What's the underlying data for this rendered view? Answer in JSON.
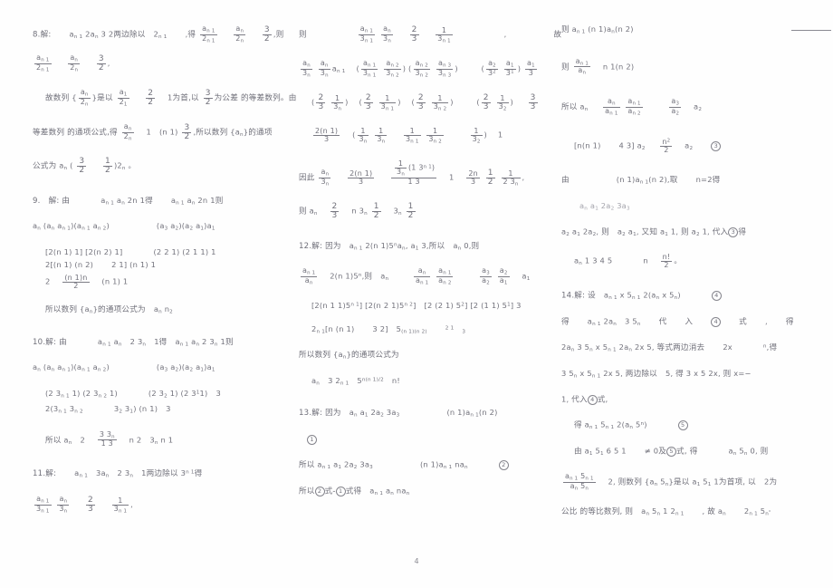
{
  "document": {
    "kind": "scanned-math-answer-key",
    "page_number": "4",
    "language": "zh-CN"
  },
  "columns": {
    "left": {
      "problems": [
        {
          "number": "8.",
          "label": "解:",
          "lines": [
            {
              "id": "l8-1",
              "text": "8.解:　　 a n 1  2a n  3 2两边除以　 2 n 1　　,得"
            },
            {
              "id": "l8-1f",
              "fraction_a_num": "a n 1",
              "fraction_a_den": "2 n 1",
              "fraction_b_num": "a n",
              "fraction_b_den": "2 n",
              "fraction_c_num": "3",
              "fraction_c_den": "2",
              "tail": "则"
            },
            {
              "id": "l8-2",
              "text": ""
            },
            {
              "id": "l8-3",
              "text": "故数列 {",
              "inner": "a n",
              "inner_den": "2 n",
              "text2": "}是以",
              "frac1_num": "a 1",
              "frac1_den": "2 1",
              "frac2_num": "2",
              "frac2_den": "2",
              "mid": "1为首,以",
              "frac3_num": "3",
              "frac3_den": "2",
              "tail": "为公差 的等差数列,由"
            },
            {
              "id": "l8-4",
              "text": "等差数列 的通项公式,得",
              "frac_num": "a n",
              "frac_den": "2 n",
              "mid": "1　(n 1)",
              "frac2_num": "3",
              "frac2_den": "2",
              "tail": ",所以数列 {a n }的通项"
            },
            {
              "id": "l8-5",
              "text": "公式为 a n  (",
              "frac1_num": "3",
              "frac1_den": "2",
              "frac2_num": "1",
              "frac2_den": "2",
              "tail": ")2 n 。"
            }
          ]
        },
        {
          "number": "9.",
          "label": "解: 由",
          "lines": [
            {
              "id": "l9-1",
              "text": "9.　解: 由　　　 a n 1  a n  2n  1得　　 a n 1  a n  2n  1则"
            },
            {
              "id": "l9-2",
              "text": "a n  (a n  a n 1 ) (a n 1  a n 2 )　　　　 (a 3  a 2 ) (a 2  a 1 ) a 1"
            },
            {
              "id": "l9-3",
              "text": "[2(n 1)  1] [2(n 2)  1]　　 (2 2 1) (2 1 1) 1"
            },
            {
              "id": "l9-4",
              "text": "2[(n 1) (n 2)　　　 2 1] (n 1)  1"
            },
            {
              "id": "l9-5",
              "text": "2",
              "frac_num": "(n 1)n",
              "frac_den": "2",
              "tail": "(n 1) 1"
            },
            {
              "id": "l9-6",
              "text": "所以数列 {a n }的通项公式为　 a n  n 2"
            }
          ]
        },
        {
          "number": "10.",
          "label": "解: 由",
          "lines": [
            {
              "id": "l10-1",
              "text": "10.解: 由　　　 a n 1  a n 　 2 3 n 　1得　 a n 1  a n  2 3 n  1则"
            },
            {
              "id": "l10-2",
              "text": "a n  (a n  a n 1 ) (a n 1  a n 2 )　　　　 (a 3  a 2 ) (a 2  a 1 ) a 1"
            },
            {
              "id": "l10-3",
              "text": "(2 3 n 1  1) (2 3 n 2  1)　　　 (2 3 2  1) (2 3 1 1)  3"
            },
            {
              "id": "l10-4",
              "text": "2(3 n 1  3 n 2 　　　 3 2  3 1 ) (n 1)  3"
            },
            {
              "id": "l10-5",
              "text": "所以 a n  2",
              "frac_num": "3  3 n",
              "frac_den": "1  3",
              "tail": "n  2  3 n  n  1"
            }
          ]
        },
        {
          "number": "11.",
          "label": "解:",
          "lines": [
            {
              "id": "l11-1",
              "text": "11.解:　 a n 1  3a n 　 2 3 n 　1两边除以 3 n 1 得"
            },
            {
              "id": "l11-2",
              "frac1_num": "a n 1",
              "frac1_den": "3 n 1",
              "frac2_num": "a n",
              "frac2_den": "3 n",
              "frac3_num": "2",
              "frac3_den": "3",
              "frac4_num": "1",
              "frac4_den": "3 n 1",
              "tail": ","
            }
          ]
        }
      ]
    },
    "middle": {
      "problems": [
        {
          "number": "11. (cont.)",
          "lines": [
            {
              "id": "m-1",
              "lead": "则",
              "frac1_num": "a n 1",
              "frac1_den": "3 n 1",
              "frac2_num": "a n",
              "frac2_den": "3 n",
              "frac3_num": "2",
              "frac3_den": "3",
              "frac4_num": "1",
              "frac4_den": "3 n 1",
              "tail": ",　　　　　 故"
            },
            {
              "id": "m-2",
              "frac1_num": "a n",
              "frac1_den": "3 n",
              "mid": "a  n a",
              "mid2": "3  n  a n 1",
              "text": "(",
              "f2n": "a n 1",
              "f2d": "3 n 1",
              "f3n": "a n 2",
              "f3d": "3 n 2",
              "f4n": "a n 2  a n 3",
              "f4d": "3 n 2  3 n 3",
              "f5n": "a 2  a 1",
              "f5d": "3 2  3 1",
              "f6n": "a 1",
              "f6d": "3"
            },
            {
              "id": "m-3",
              "text": "(",
              "f1n": "2",
              "f1d": "3",
              "f2n": "1",
              "f2d": "3 n",
              "t1": ") (",
              "f3n": "2",
              "f3d": "3",
              "f4n": "1",
              "f4d": "3 n 1",
              "t2": ") (",
              "f5n": "2",
              "f5d": "3",
              "f6n": "1",
              "f6d": "3 n 2",
              "t3": ")　　 (",
              "f7n": "2",
              "f7d": "3",
              "f8n": "1",
              "f8d": "3 2",
              "t4": ")",
              "f9n": "3",
              "f9d": "3"
            },
            {
              "id": "m-4",
              "fAn": "2(n 1)",
              "fAd": "3",
              "t1": "(",
              "fBn": "1",
              "fBd": "3 n",
              "fCn": "1",
              "fCd": "3 n",
              "fDn": "1",
              "fDd": "3 n 1",
              "fEn": "1",
              "fEd": "3 n 2",
              "t2": "　　",
              "fFn": "1",
              "fFd": "3 2",
              "t3": ") 1"
            },
            {
              "id": "m-5",
              "lead": "因此",
              "fAn": "a n",
              "fAd": "3 n",
              "fBn": "2(n 1)",
              "fBd": "3",
              "fCn_top": "1",
              "fCn_bot": "3 n",
              "fCn_tail": "(1  3 n 1 )",
              "fCd": "1  3",
              "t1": "1",
              "fDn": "2n",
              "fDd": "3",
              "fEn": "1",
              "fEd": "2",
              "fFn": "1",
              "fFd": "2  3 n",
              "t2": ","
            },
            {
              "id": "m-6",
              "lead": "则 a n",
              "fAn": "2",
              "fAd": "3",
              "t1": "n  3 n",
              "fBn": "1",
              "fBd": "2",
              "t2": "3 n",
              "fCn": "1",
              "fCd": "2"
            }
          ]
        },
        {
          "number": "12.",
          "label": "解: 因为",
          "lines": [
            {
              "id": "m12-1",
              "text": "12.解: 因为　 a n 1  2(n  1)5 n a n , a 1  3,所以　 a n  0,则"
            },
            {
              "id": "m12-2",
              "fAn": "a n 1",
              "fAd": "a n",
              "t1": "2(n  1)5 n , 则　 a n",
              "fBn": "a n",
              "fBd": "a n 1",
              "fCn": "a n 1",
              "fCd": "a n 2",
              "fDn": "a 3",
              "fDd": "a 2",
              "fEn": "a 2",
              "fEd": "a 1",
              "t2": "a 1"
            },
            {
              "id": "m12-3",
              "text": "[2(n  1  1)5 n 1 ] [2(n  2  1)5 n 2 ]　 [2 (2  1)  5 2 ] [2 (1  1)  5 1 ] 3"
            },
            {
              "id": "m12-4",
              "text": "2 n 1 [n  (n  1)　　　 3  2] 5 (n 1) (n 2)　 2 1　3"
            },
            {
              "id": "m12-5",
              "text": "所以数列 {a n }的通项公式为"
            },
            {
              "id": "m12-6",
              "text": "a n  3  2 n 1  5",
              "exp": "n(n 1)/2",
              "tail": "n!"
            }
          ]
        },
        {
          "number": "13.",
          "label": "解: 因为",
          "lines": [
            {
              "id": "m13-1",
              "text": "13.解: 因为　 a n  a 1  2a 2  3a 3 　　　　 (n  1)a n 1 (n  2)"
            },
            {
              "id": "m13-2",
              "text": "①"
            },
            {
              "id": "m13-3",
              "text": "所以 a n 1  a 1  2a 2  3a 3 　　　 (n  1)a n 1  na n 　　　 ②"
            },
            {
              "id": "m13-4",
              "text": "所以②式-①式得　 a n 1  a n  na n"
            }
          ]
        }
      ]
    },
    "right": {
      "problems": [
        {
          "number": "13. (cont.)",
          "lines": [
            {
              "id": "r-1",
              "text": "则 a n 1  (n  1)a n (n  2)"
            },
            {
              "id": "r-2",
              "lead": "则",
              "fAn": "a n 1",
              "fAd": "a n",
              "tail": "n  1(n  2)"
            },
            {
              "id": "r-3",
              "lead": "所以 a n",
              "fAn": "a n",
              "fAd": "a n 1",
              "fBn": "a n 1",
              "fBd": "a n 2",
              "fCn": "a 3",
              "fCd": "a 2",
              "tail": "a 2"
            },
            {
              "id": "r-4",
              "text": "[n(n  1)　　 4 3] a 2",
              "fAn": "n!",
              "fAd": "2",
              "tail": "a 2　　 ③"
            },
            {
              "id": "r-5",
              "lead": "由",
              "sub": "a n  a 1  2a 2  3a 3",
              "tail": "(n  1)a n 1 (n  2), 取　 n=2得"
            },
            {
              "id": "r-6",
              "text": "a 2  a 1  2a 2 , 则　 a 2  a 1 , 又知 a 1  1, 则 a 2  1, 代入③得"
            },
            {
              "id": "r-7",
              "text": "a n  1 3  4 5　　 n",
              "fAn": "n!",
              "fAd": "2",
              "tail": "。"
            }
          ]
        },
        {
          "number": "14.",
          "label": "解: 设",
          "lines": [
            {
              "id": "r14-1",
              "text": "14.解: 设　 a n 1  x  5 n 1  2(a n  x  5 n )　　　 ④"
            },
            {
              "id": "r14-2",
              "text": "得　　 a n 1  2a n 　3  5 n 　　代　 入　 ④　 式　 ,　　 得"
            },
            {
              "id": "r14-3",
              "text": "2a n  3  5 n  x  5 n 1  2a n  2x  5 n , 等式两边消去　　 2a n 　 , 得"
            },
            {
              "id": "r14-4",
              "text": "3  5 n  x  5 n 1  2x  5 n , 两边除以　 5 n , 得 3  x  5  2x, 则 x=-"
            },
            {
              "id": "r14-5",
              "text": "1, 代入④式,"
            },
            {
              "id": "r14-6",
              "text": "得 a n 1  5 n 1  2(a n  5 n )　　　 ⑤"
            },
            {
              "id": "r14-7",
              "text": "由 a 1  5 1  6  5  1　 ≠ 0及⑤式, 得　　 a n  5 n  0, 则"
            },
            {
              "id": "r14-8",
              "fAn": "a n 1  5 n 1",
              "fAd": "a n  5 n",
              "tail": "2, 则数列 {a n  5 n }是以 a 1  5 1  1为首项, 以　 2为"
            },
            {
              "id": "r14-9",
              "text": "公比 的等比数列, 则　 a n  5 n  1 2 n 1 　 , 故 a n 　 2 n 1  5 n 。"
            }
          ]
        }
      ]
    }
  }
}
